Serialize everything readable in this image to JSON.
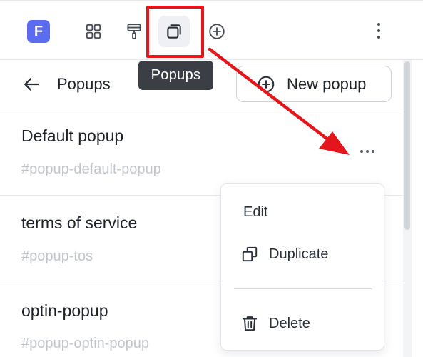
{
  "toolbar": {
    "logo_letter": "F",
    "tools": [
      {
        "icon": "grid-icon",
        "active": false
      },
      {
        "icon": "paint-roller-icon",
        "active": true
      },
      {
        "icon": "popups-icon",
        "active": true
      },
      {
        "icon": "plus-circle-icon",
        "active": false
      }
    ],
    "more_icon": "kebab-vertical-icon"
  },
  "tooltip": {
    "text": "Popups"
  },
  "panel": {
    "title": "Popups",
    "new_button_label": "New popup"
  },
  "popups": [
    {
      "title": "Default popup",
      "slug": "#popup-default-popup"
    },
    {
      "title": "terms of service",
      "slug": "#popup-tos"
    },
    {
      "title": "optin-popup",
      "slug": "#popup-optin-popup"
    }
  ],
  "context_menu": {
    "items": [
      {
        "label": "Edit",
        "icon": ""
      },
      {
        "label": "Duplicate",
        "icon": "duplicate-icon"
      },
      {
        "label": "Delete",
        "icon": "trash-icon"
      }
    ]
  },
  "colors": {
    "brand": "#5b6cf0",
    "annotation": "#e3161b",
    "tooltip_bg": "#3b3f45"
  }
}
